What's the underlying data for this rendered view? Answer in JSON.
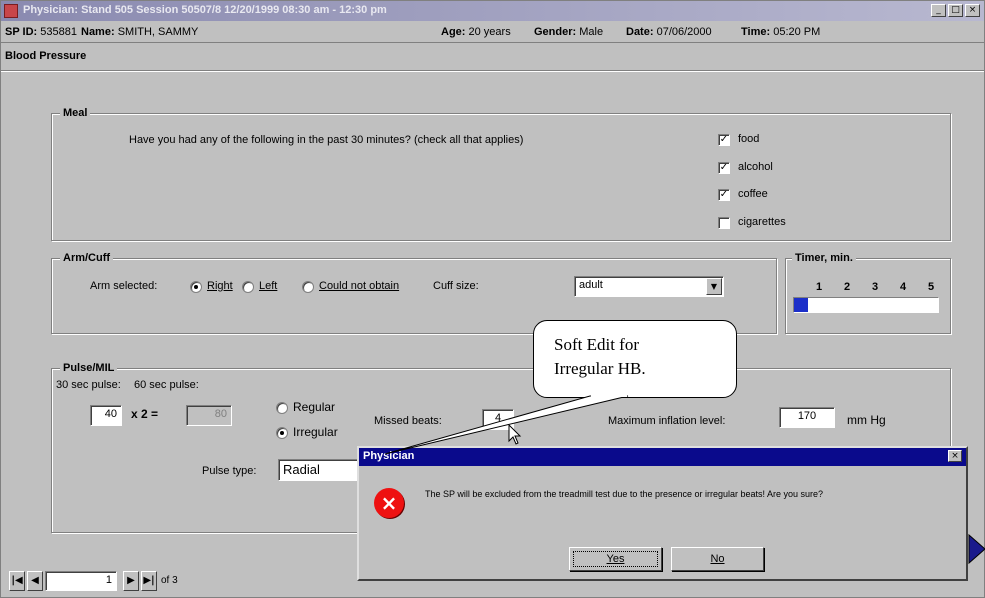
{
  "window": {
    "title": "Physician: Stand 505 Session 50507/8 12/20/1999 08:30 am - 12:30 pm",
    "min": "_",
    "max": "□",
    "close": "×"
  },
  "info": {
    "sp_id_label": "SP ID:",
    "sp_id": "535881",
    "name_label": "Name:",
    "name": "SMITH, SAMMY",
    "age_label": "Age:",
    "age": "20 years",
    "gender_label": "Gender:",
    "gender": "Male",
    "date_label": "Date:",
    "date": "07/06/2000",
    "time_label": "Time:",
    "time": "05:20 PM"
  },
  "section_title": "Blood Pressure",
  "meal": {
    "group_label": "Meal",
    "question": "Have you had any of the following in the past 30 minutes? (check all that applies)",
    "options": [
      {
        "label": "food",
        "checked": true
      },
      {
        "label": "alcohol",
        "checked": true
      },
      {
        "label": "coffee",
        "checked": true
      },
      {
        "label": "cigarettes",
        "checked": false
      }
    ],
    "check_glyph": "✓"
  },
  "arm": {
    "group_label": "Arm/Cuff",
    "arm_label": "Arm selected:",
    "options": [
      "Right",
      "Left",
      "Could not obtain"
    ],
    "cuff_label": "Cuff size:",
    "cuff_value": "adult",
    "dropdown_glyph": "▼"
  },
  "timer": {
    "label": "Timer, min.",
    "ticks": [
      "1",
      "2",
      "3",
      "4",
      "5"
    ],
    "progress": 0.1
  },
  "pulse": {
    "group_label": "Pulse/MIL",
    "sec30_label": "30 sec pulse:",
    "sec60_label": "60 sec pulse:",
    "sec30_value": "40",
    "times_label": "x 2 =",
    "sec60_value": "80",
    "regular_label": "Regular",
    "irregular_label": "Irregular",
    "missed_label": "Missed beats:",
    "missed_value": "4",
    "max_inflation_label": "Maximum inflation level:",
    "max_inflation_value": "170",
    "mmhg": "mm Hg",
    "type_label": "Pulse type:",
    "type_value": "Radial"
  },
  "nav": {
    "first": "|◀",
    "prev": "◀",
    "next": "▶",
    "last": "▶|",
    "page_value": "1",
    "of_label": "of 3"
  },
  "callout": {
    "line1": "Soft Edit for",
    "line2": "Irregular HB."
  },
  "dialog": {
    "title": "Physician",
    "close": "×",
    "icon": "×",
    "message": "The SP will be excluded from the treadmill test due to the presence or irregular beats! Are you sure?",
    "yes": "Yes",
    "no": "No"
  }
}
